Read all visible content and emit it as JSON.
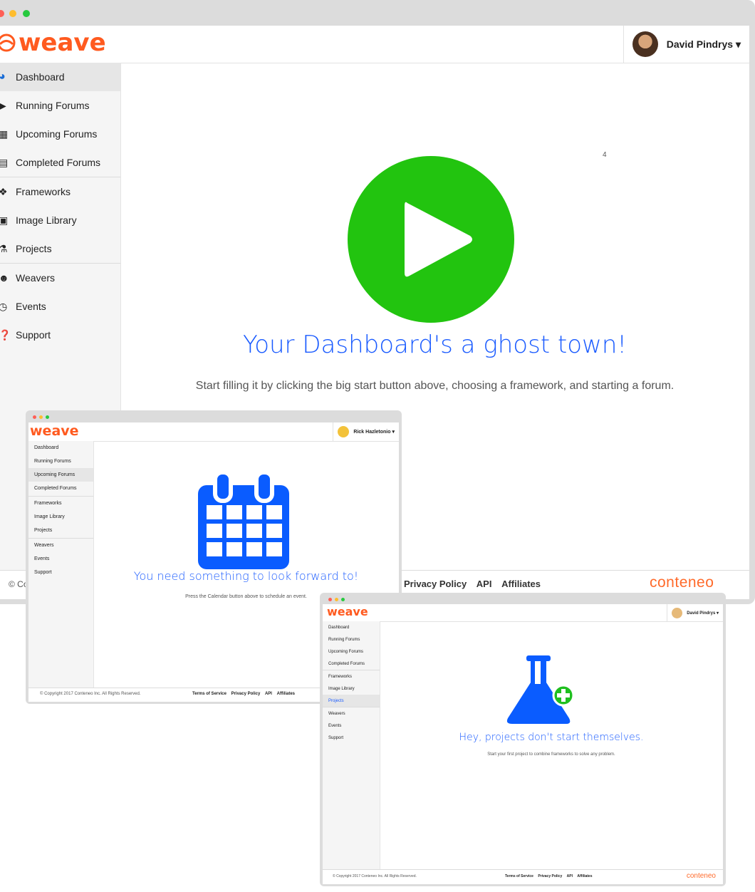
{
  "main": {
    "logo": "weave",
    "user": "David Pindrys ▾",
    "sidebar": [
      {
        "label": "Dashboard",
        "icon": "dashboard-icon"
      },
      {
        "label": "Running Forums",
        "icon": "play-icon"
      },
      {
        "label": "Upcoming Forums",
        "icon": "calendar-icon"
      },
      {
        "label": "Completed Forums",
        "icon": "document-icon"
      },
      {
        "label": "Frameworks",
        "icon": "cubes-icon"
      },
      {
        "label": "Image Library",
        "icon": "image-icon"
      },
      {
        "label": "Projects",
        "icon": "flask-icon"
      },
      {
        "label": "Weavers",
        "icon": "users-icon"
      },
      {
        "label": "Events",
        "icon": "clock-icon"
      },
      {
        "label": "Support",
        "icon": "question-icon"
      }
    ],
    "small_number": "4",
    "headline": "Your Dashboard's a ghost town!",
    "subtext": "Start filling it by clicking the big start button above, choosing a framework, and starting a forum.",
    "footer_left": "© Co",
    "footer_links": [
      "Privacy Policy",
      "API",
      "Affiliates"
    ],
    "brand": "conteneo"
  },
  "second": {
    "logo": "weave",
    "user": "Rick Hazletonio ▾",
    "sidebar": [
      "Dashboard",
      "Running Forums",
      "Upcoming Forums",
      "Completed Forums",
      "Frameworks",
      "Image Library",
      "Projects",
      "Weavers",
      "Events",
      "Support"
    ],
    "headline": "You need something to look forward to!",
    "subtext": "Press the Calendar button above to schedule an event.",
    "footer_left": "© Copyright 2017 Conteneo Inc. All Rights Reserved.",
    "footer_links": [
      "Terms of Service",
      "Privacy Policy",
      "API",
      "Affiliates"
    ]
  },
  "third": {
    "logo": "weave",
    "user": "David Pindrys ▾",
    "sidebar": [
      "Dashboard",
      "Running Forums",
      "Upcoming Forums",
      "Completed Forums",
      "Frameworks",
      "Image Library",
      "Projects",
      "Weavers",
      "Events",
      "Support"
    ],
    "headline": "Hey, projects don't start themselves.",
    "subtext": "Start your first project to combine frameworks to solve any problem.",
    "footer_left": "© Copyright 2017 Conteneo Inc. All Rights Reserved.",
    "footer_links": [
      "Terms of Service",
      "Privacy Policy",
      "API",
      "Affiliates"
    ],
    "brand": "conteneo"
  },
  "colors": {
    "accent": "#ff5a1f",
    "play": "#22c40f",
    "blue": "#0a5cff",
    "green_plus": "#1fbf1f"
  }
}
